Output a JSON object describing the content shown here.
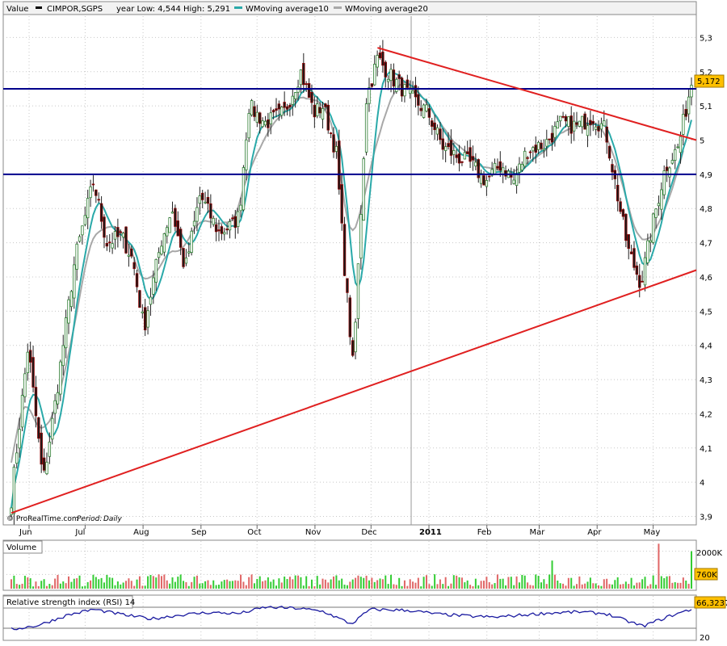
{
  "header": {
    "value_label": "Value",
    "symbol": "CIMPOR,SGPS",
    "range_text": "year Low: 4,544 High: 5,291",
    "legend": [
      {
        "name": "WMoving average10",
        "color": "#2aa9a9"
      },
      {
        "name": "WMoving average20",
        "color": "#a8a8a8"
      }
    ]
  },
  "credit": {
    "source": "© ProRealTime.com",
    "period_label": "Period:",
    "period_value": "Daily"
  },
  "colors": {
    "up": "#2e7d32",
    "down": "#8b0000",
    "hline": "#00008b",
    "trend": "#e02020",
    "ma10": "#2aa9a9",
    "ma20": "#a8a8a8",
    "price_badge": "#ffc000",
    "vol_up": "#33cc33",
    "vol_down": "#e06666",
    "rsi": "#1a1aa0",
    "grid": "#c8c8c8"
  },
  "chart_data": [
    {
      "type": "candlestick",
      "title": "CIMPOR,SGPS",
      "period": "Daily",
      "x_tick_labels": [
        "Jun",
        "Jul",
        "Aug",
        "Sep",
        "Oct",
        "Nov",
        "Dec",
        "2011",
        "Feb",
        "Mar",
        "Apr",
        "May"
      ],
      "y_tick_labels": [
        "3,9",
        "4",
        "4,1",
        "4,2",
        "4,3",
        "4,4",
        "4,5",
        "4,6",
        "4,7",
        "4,8",
        "4,9",
        "5",
        "5,1",
        "5,2",
        "5,3"
      ],
      "ylim": [
        3.88,
        5.36
      ],
      "grid": true,
      "last_price_label": "5,172",
      "horizontal_lines": [
        5.15,
        4.9
      ],
      "trend_lines": [
        {
          "from": [
            "2010-06-01",
            3.91
          ],
          "to": [
            "2011-05-31",
            4.62
          ]
        },
        {
          "from": [
            "2010-12-14",
            5.27
          ],
          "to": [
            "2011-05-31",
            5.0
          ]
        }
      ],
      "series_names": [
        "CIMPOR,SGPS",
        "WMoving average10",
        "WMoving average20"
      ],
      "path": [
        [
          "2010-06-01",
          3.95
        ],
        [
          "2010-06-10",
          4.4
        ],
        [
          "2010-06-18",
          4.0
        ],
        [
          "2010-06-25",
          4.25
        ],
        [
          "2010-07-05",
          4.65
        ],
        [
          "2010-07-15",
          4.88
        ],
        [
          "2010-07-22",
          4.7
        ],
        [
          "2010-07-30",
          4.72
        ],
        [
          "2010-08-05",
          4.65
        ],
        [
          "2010-08-11",
          4.45
        ],
        [
          "2010-08-20",
          4.7
        ],
        [
          "2010-08-26",
          4.8
        ],
        [
          "2010-09-02",
          4.62
        ],
        [
          "2010-09-10",
          4.84
        ],
        [
          "2010-09-20",
          4.73
        ],
        [
          "2010-09-27",
          4.75
        ],
        [
          "2010-10-01",
          4.78
        ],
        [
          "2010-10-06",
          5.1
        ],
        [
          "2010-10-15",
          5.05
        ],
        [
          "2010-10-25",
          5.08
        ],
        [
          "2010-11-03",
          5.2
        ],
        [
          "2010-11-10",
          5.08
        ],
        [
          "2010-11-15",
          5.1
        ],
        [
          "2010-11-22",
          4.96
        ],
        [
          "2010-11-26",
          4.65
        ],
        [
          "2010-12-01",
          4.33
        ],
        [
          "2010-12-08",
          5.12
        ],
        [
          "2010-12-14",
          5.24
        ],
        [
          "2010-12-22",
          5.18
        ],
        [
          "2010-12-31",
          5.13
        ],
        [
          "2011-01-10",
          5.08
        ],
        [
          "2011-01-18",
          4.98
        ],
        [
          "2011-01-26",
          4.95
        ],
        [
          "2011-02-02",
          4.93
        ],
        [
          "2011-02-10",
          4.88
        ],
        [
          "2011-02-18",
          4.93
        ],
        [
          "2011-02-25",
          4.88
        ],
        [
          "2011-03-04",
          4.97
        ],
        [
          "2011-03-14",
          4.99
        ],
        [
          "2011-03-22",
          5.05
        ],
        [
          "2011-03-31",
          5.04
        ],
        [
          "2011-04-08",
          5.07
        ],
        [
          "2011-04-15",
          5.03
        ],
        [
          "2011-04-21",
          4.85
        ],
        [
          "2011-04-27",
          4.68
        ],
        [
          "2011-05-04",
          4.58
        ],
        [
          "2011-05-10",
          4.75
        ],
        [
          "2011-05-17",
          4.92
        ],
        [
          "2011-05-24",
          4.98
        ],
        [
          "2011-05-31",
          5.17
        ]
      ]
    },
    {
      "type": "bar",
      "title": "Volume",
      "y_tick_labels": [
        "2000K",
        "760K"
      ],
      "ylim": [
        0,
        2500
      ],
      "current_value_label": "760K",
      "spikes": [
        {
          "date": "2011-03-18",
          "value": 1500,
          "direction": "up"
        },
        {
          "date": "2011-05-13",
          "value": 2400,
          "direction": "down"
        },
        {
          "date": "2011-05-31",
          "value": 2000,
          "direction": "up"
        }
      ]
    },
    {
      "type": "line",
      "title": "Relative strength index (RSI) 14",
      "y_tick_labels": [
        "20"
      ],
      "ylim": [
        10,
        90
      ],
      "current_value_label": "66,3237",
      "reference_lines": [
        30,
        70
      ],
      "path": [
        [
          "2010-06-01",
          28
        ],
        [
          "2010-06-15",
          35
        ],
        [
          "2010-07-01",
          55
        ],
        [
          "2010-07-15",
          66
        ],
        [
          "2010-08-01",
          55
        ],
        [
          "2010-08-15",
          48
        ],
        [
          "2010-09-01",
          56
        ],
        [
          "2010-09-15",
          60
        ],
        [
          "2010-10-01",
          58
        ],
        [
          "2010-10-15",
          70
        ],
        [
          "2010-11-01",
          68
        ],
        [
          "2010-11-15",
          62
        ],
        [
          "2010-11-30",
          38
        ],
        [
          "2010-12-10",
          66
        ],
        [
          "2010-12-31",
          64
        ],
        [
          "2011-01-15",
          57
        ],
        [
          "2011-02-01",
          53
        ],
        [
          "2011-02-15",
          51
        ],
        [
          "2011-03-01",
          55
        ],
        [
          "2011-03-15",
          59
        ],
        [
          "2011-04-01",
          61
        ],
        [
          "2011-04-15",
          58
        ],
        [
          "2011-04-28",
          42
        ],
        [
          "2011-05-05",
          34
        ],
        [
          "2011-05-20",
          54
        ],
        [
          "2011-05-31",
          66
        ]
      ]
    }
  ]
}
